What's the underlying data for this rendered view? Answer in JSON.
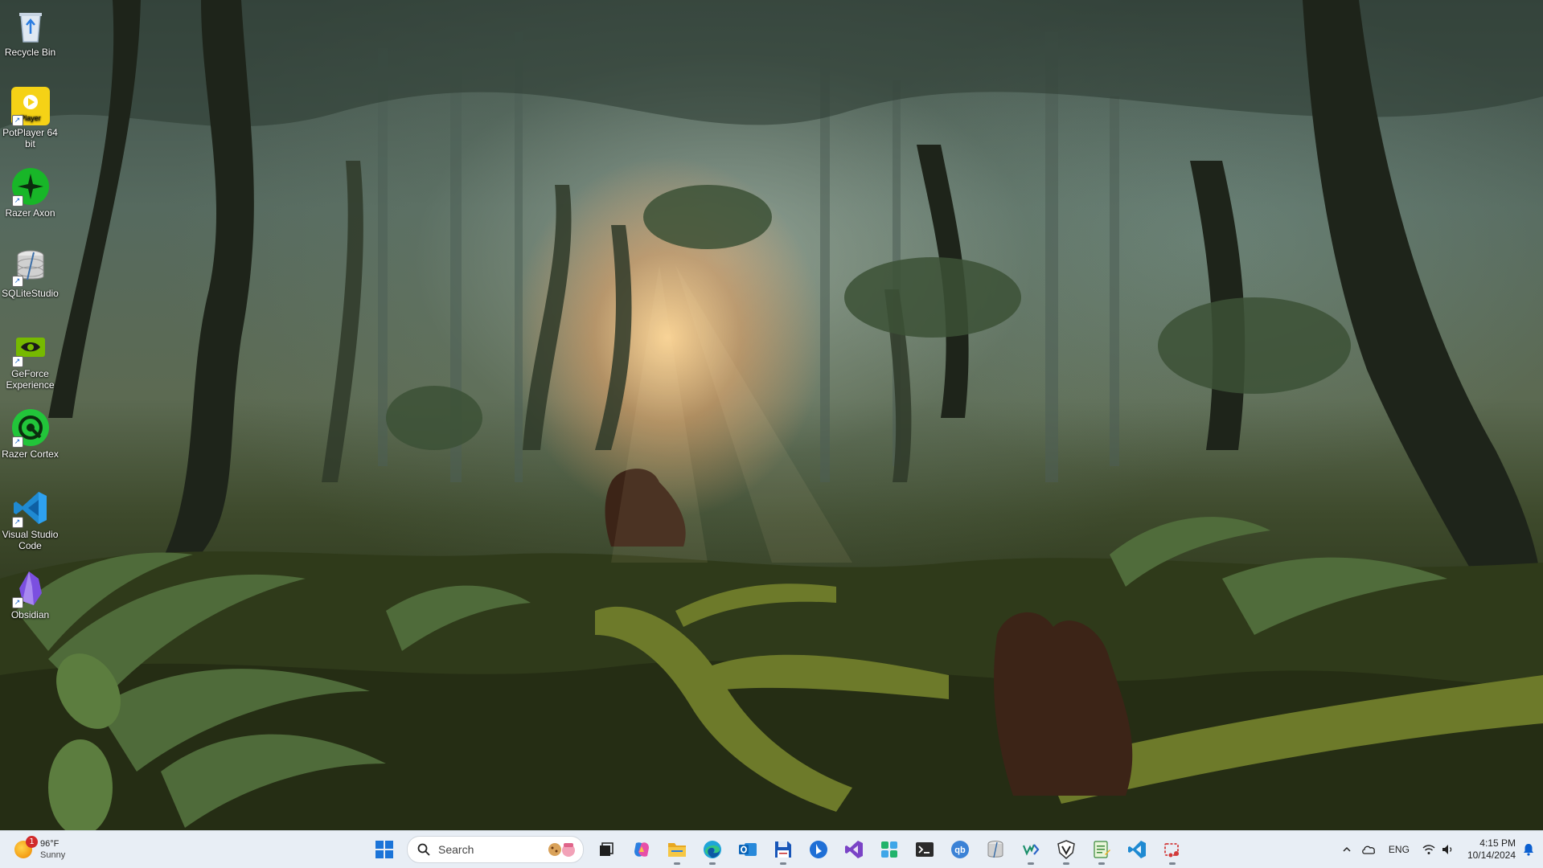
{
  "desktop": {
    "icons": [
      {
        "label": "Recycle Bin",
        "icon": "recycle-bin-icon"
      },
      {
        "label": "PotPlayer 64 bit",
        "icon": "potplayer-icon",
        "glyph_text": "Player"
      },
      {
        "label": "Razer Axon",
        "icon": "razer-axon-icon"
      },
      {
        "label": "SQLiteStudio",
        "icon": "sqlitestudio-icon"
      },
      {
        "label": "GeForce Experience",
        "icon": "geforce-experience-icon"
      },
      {
        "label": "Razer Cortex",
        "icon": "razer-cortex-icon"
      },
      {
        "label": "Visual Studio Code",
        "icon": "vscode-icon"
      },
      {
        "label": "Obsidian",
        "icon": "obsidian-icon"
      }
    ]
  },
  "taskbar": {
    "weather": {
      "temperature": "96°F",
      "condition": "Sunny",
      "badge": "1"
    },
    "search": {
      "placeholder": "Search"
    },
    "pinned": [
      {
        "name": "start-button",
        "icon": "windows-logo-icon"
      },
      {
        "name": "task-view",
        "icon": "task-view-icon"
      },
      {
        "name": "copilot",
        "icon": "copilot-icon"
      },
      {
        "name": "file-explorer",
        "icon": "folder-icon"
      },
      {
        "name": "edge",
        "icon": "edge-icon"
      },
      {
        "name": "outlook",
        "icon": "outlook-icon"
      },
      {
        "name": "save-app",
        "icon": "floppy-disk-icon"
      },
      {
        "name": "bing-app",
        "icon": "bing-icon"
      },
      {
        "name": "visual-studio",
        "icon": "visual-studio-icon"
      },
      {
        "name": "puzzle-app",
        "icon": "puzzle-icon"
      },
      {
        "name": "terminal",
        "icon": "terminal-icon"
      },
      {
        "name": "qbittorrent",
        "icon": "qbittorrent-icon",
        "glyph_text": "qb"
      },
      {
        "name": "sqlitestudio",
        "icon": "sqlitestudio-icon"
      },
      {
        "name": "vk-app",
        "icon": "vk-icon"
      },
      {
        "name": "vpn-app",
        "icon": "shield-v-icon"
      },
      {
        "name": "notepad-app",
        "icon": "notepad-icon"
      },
      {
        "name": "vscode",
        "icon": "vscode-icon"
      },
      {
        "name": "snipping-tool",
        "icon": "snipping-tool-icon"
      }
    ],
    "tray": {
      "language": "ENG",
      "time": "4:15 PM",
      "date": "10/14/2024"
    },
    "colors": {
      "bar": "#e8eef5",
      "accent": "#0078d4"
    }
  }
}
